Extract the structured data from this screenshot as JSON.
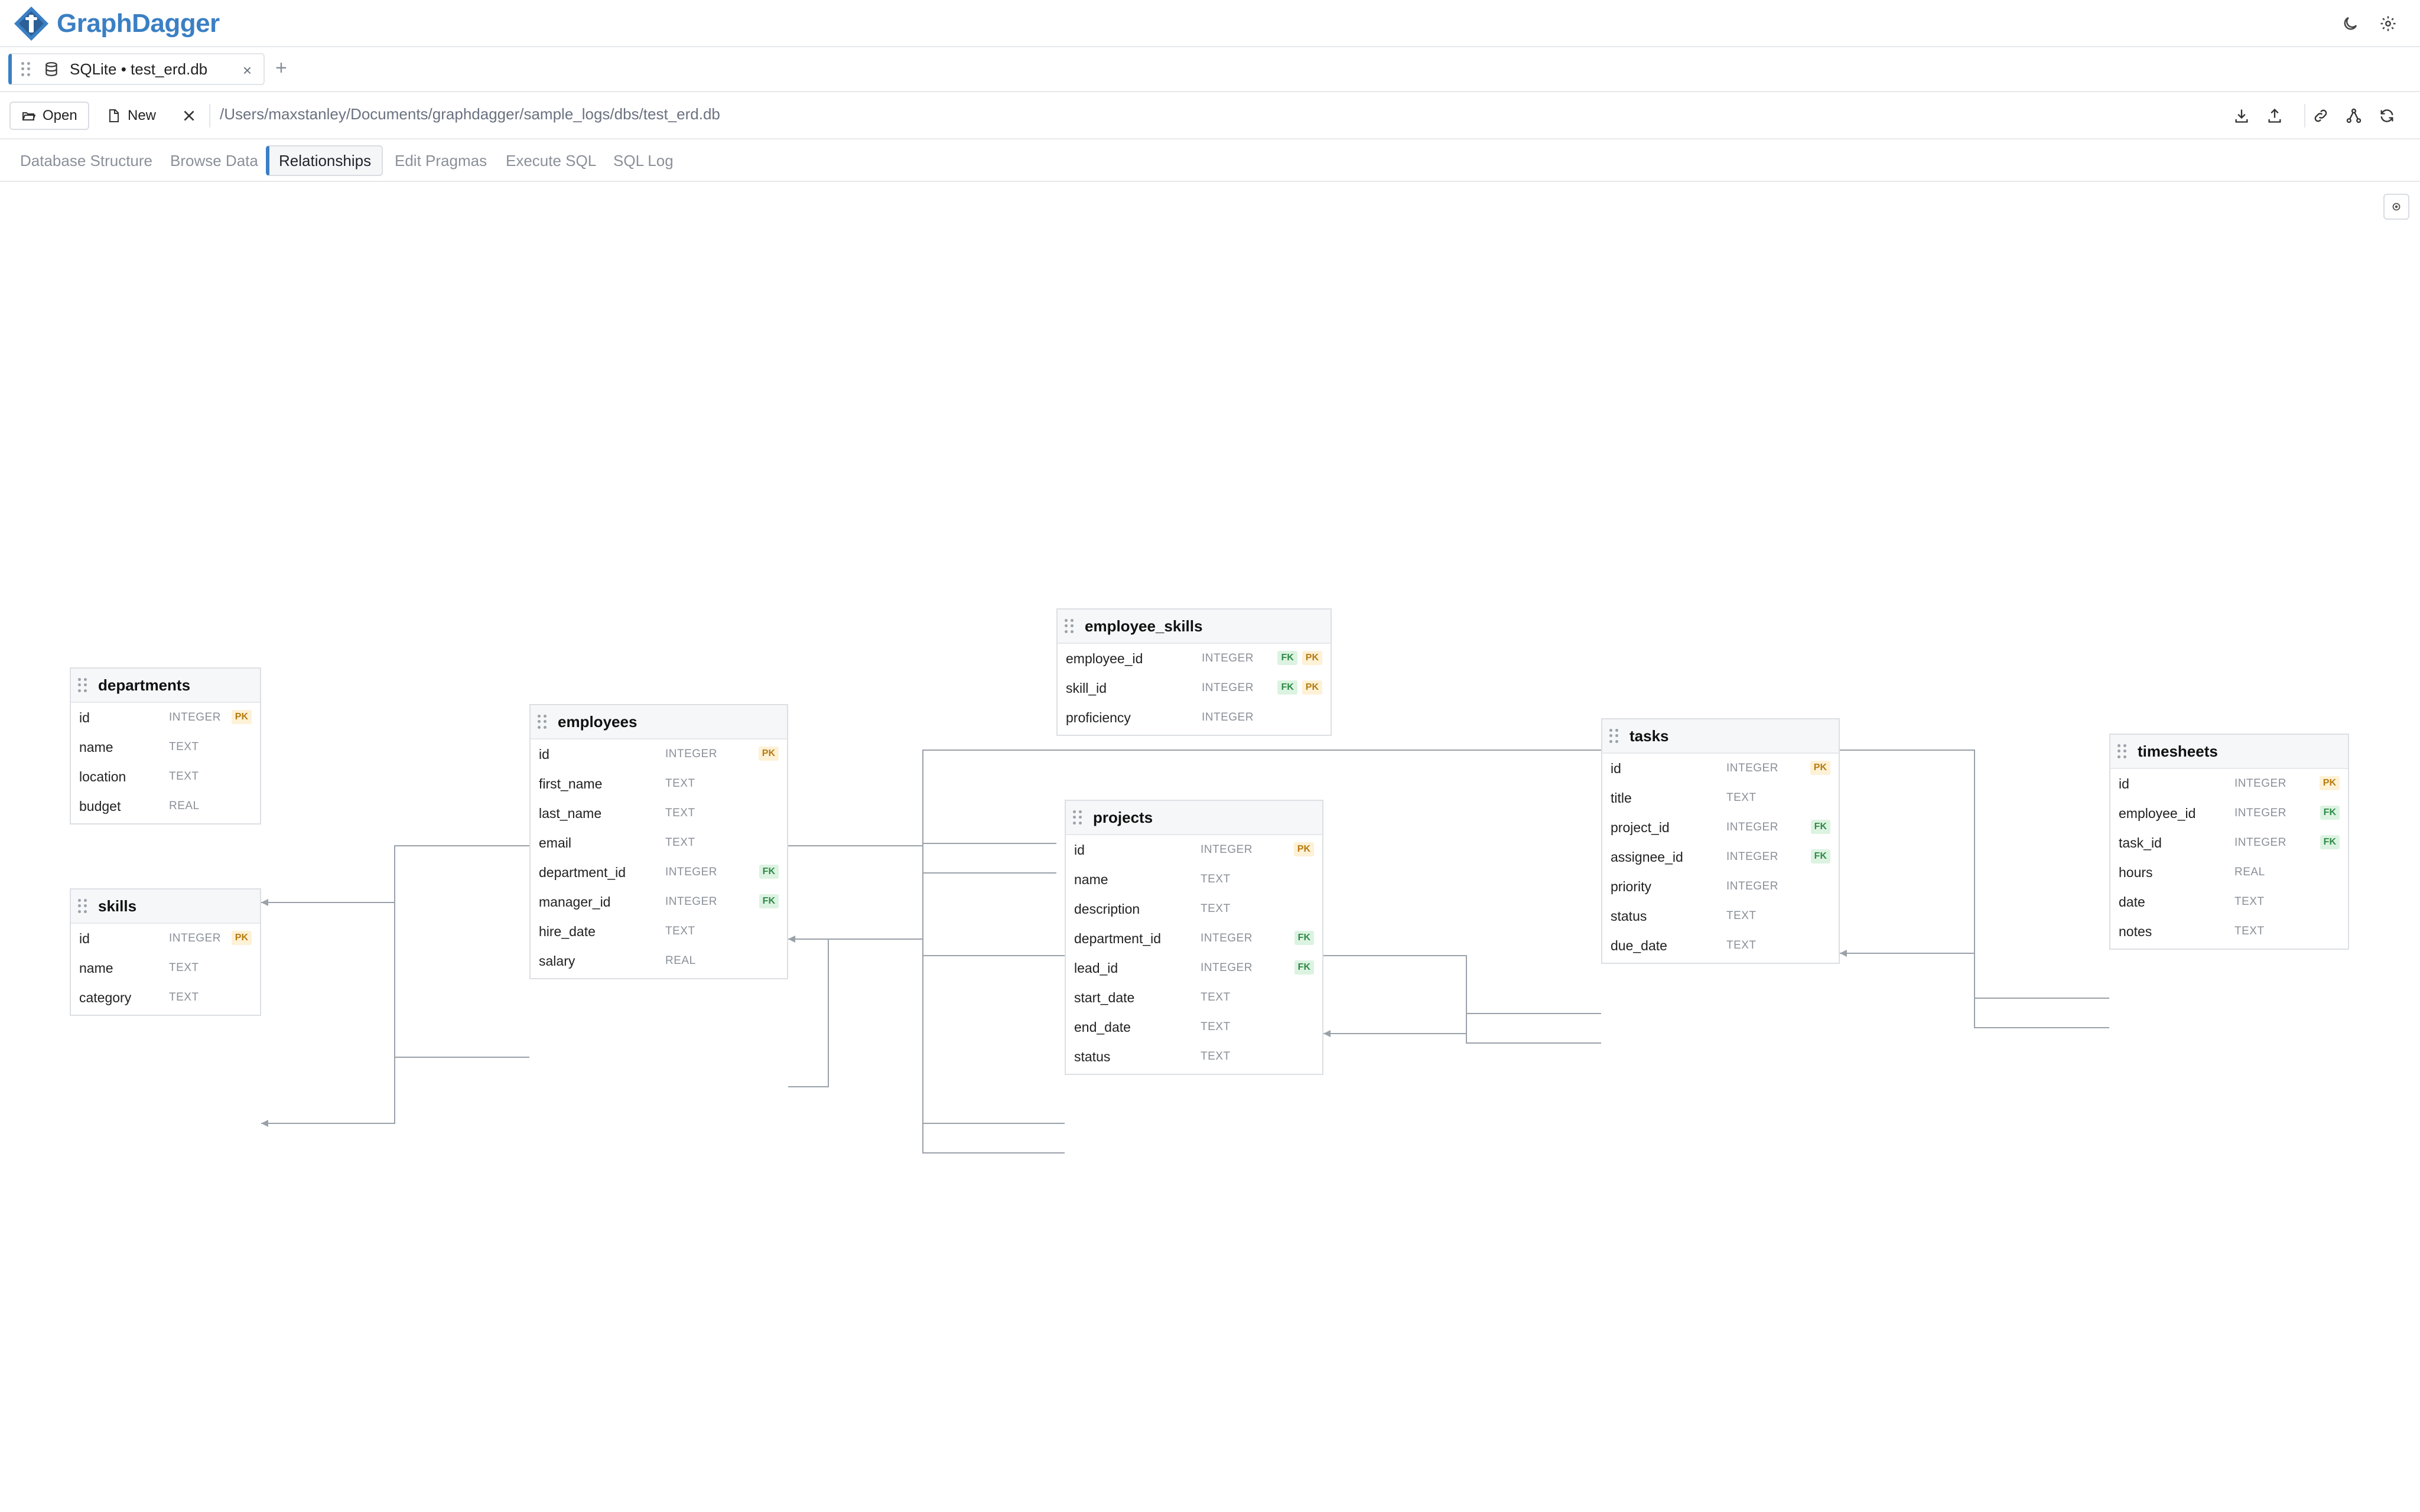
{
  "app": {
    "name": "GraphDagger"
  },
  "db_tab": {
    "label": "SQLite • test_erd.db",
    "close": "×",
    "add": "+"
  },
  "toolbar": {
    "open_label": "Open",
    "new_label": "New",
    "db_path": "/Users/maxstanley/Documents/graphdagger/sample_logs/dbs/test_erd.db"
  },
  "nav_tabs": [
    {
      "label": "Database Structure"
    },
    {
      "label": "Browse Data"
    },
    {
      "label": "Relationships",
      "active": true
    },
    {
      "label": "Edit Pragmas"
    },
    {
      "label": "Execute SQL"
    },
    {
      "label": "SQL Log"
    }
  ],
  "colors": {
    "accent": "#3b7fc4",
    "pk_badge": "#b77b10",
    "fk_badge": "#2f8a47",
    "edge": "#9aa1a9"
  },
  "tables": [
    {
      "name": "departments",
      "columns": [
        {
          "name": "id",
          "type": "INTEGER",
          "badges": [
            "PK"
          ]
        },
        {
          "name": "name",
          "type": "TEXT",
          "badges": []
        },
        {
          "name": "location",
          "type": "TEXT",
          "badges": []
        },
        {
          "name": "budget",
          "type": "REAL",
          "badges": []
        }
      ]
    },
    {
      "name": "skills",
      "columns": [
        {
          "name": "id",
          "type": "INTEGER",
          "badges": [
            "PK"
          ]
        },
        {
          "name": "name",
          "type": "TEXT",
          "badges": []
        },
        {
          "name": "category",
          "type": "TEXT",
          "badges": []
        }
      ]
    },
    {
      "name": "employees",
      "columns": [
        {
          "name": "id",
          "type": "INTEGER",
          "badges": [
            "PK"
          ]
        },
        {
          "name": "first_name",
          "type": "TEXT",
          "badges": []
        },
        {
          "name": "last_name",
          "type": "TEXT",
          "badges": []
        },
        {
          "name": "email",
          "type": "TEXT",
          "badges": []
        },
        {
          "name": "department_id",
          "type": "INTEGER",
          "badges": [
            "FK"
          ]
        },
        {
          "name": "manager_id",
          "type": "INTEGER",
          "badges": [
            "FK"
          ]
        },
        {
          "name": "hire_date",
          "type": "TEXT",
          "badges": []
        },
        {
          "name": "salary",
          "type": "REAL",
          "badges": []
        }
      ]
    },
    {
      "name": "employee_skills",
      "columns": [
        {
          "name": "employee_id",
          "type": "INTEGER",
          "badges": [
            "FK",
            "PK"
          ]
        },
        {
          "name": "skill_id",
          "type": "INTEGER",
          "badges": [
            "FK",
            "PK"
          ]
        },
        {
          "name": "proficiency",
          "type": "INTEGER",
          "badges": []
        }
      ]
    },
    {
      "name": "projects",
      "columns": [
        {
          "name": "id",
          "type": "INTEGER",
          "badges": [
            "PK"
          ]
        },
        {
          "name": "name",
          "type": "TEXT",
          "badges": []
        },
        {
          "name": "description",
          "type": "TEXT",
          "badges": []
        },
        {
          "name": "department_id",
          "type": "INTEGER",
          "badges": [
            "FK"
          ]
        },
        {
          "name": "lead_id",
          "type": "INTEGER",
          "badges": [
            "FK"
          ]
        },
        {
          "name": "start_date",
          "type": "TEXT",
          "badges": []
        },
        {
          "name": "end_date",
          "type": "TEXT",
          "badges": []
        },
        {
          "name": "status",
          "type": "TEXT",
          "badges": []
        }
      ]
    },
    {
      "name": "tasks",
      "columns": [
        {
          "name": "id",
          "type": "INTEGER",
          "badges": [
            "PK"
          ]
        },
        {
          "name": "title",
          "type": "TEXT",
          "badges": []
        },
        {
          "name": "project_id",
          "type": "INTEGER",
          "badges": [
            "FK"
          ]
        },
        {
          "name": "assignee_id",
          "type": "INTEGER",
          "badges": [
            "FK"
          ]
        },
        {
          "name": "priority",
          "type": "INTEGER",
          "badges": []
        },
        {
          "name": "status",
          "type": "TEXT",
          "badges": []
        },
        {
          "name": "due_date",
          "type": "TEXT",
          "badges": []
        }
      ]
    },
    {
      "name": "timesheets",
      "columns": [
        {
          "name": "id",
          "type": "INTEGER",
          "badges": [
            "PK"
          ]
        },
        {
          "name": "employee_id",
          "type": "INTEGER",
          "badges": [
            "FK"
          ]
        },
        {
          "name": "task_id",
          "type": "INTEGER",
          "badges": [
            "FK"
          ]
        },
        {
          "name": "hours",
          "type": "REAL",
          "badges": []
        },
        {
          "name": "date",
          "type": "TEXT",
          "badges": []
        },
        {
          "name": "notes",
          "type": "TEXT",
          "badges": []
        }
      ]
    }
  ],
  "relationships": [
    {
      "from": "employees.department_id",
      "to": "departments.id"
    },
    {
      "from": "employees.manager_id",
      "to": "employees.id"
    },
    {
      "from": "employee_skills.employee_id",
      "to": "employees.id"
    },
    {
      "from": "employee_skills.skill_id",
      "to": "skills.id"
    },
    {
      "from": "projects.department_id",
      "to": "departments.id"
    },
    {
      "from": "projects.lead_id",
      "to": "employees.id"
    },
    {
      "from": "tasks.project_id",
      "to": "projects.id"
    },
    {
      "from": "tasks.assignee_id",
      "to": "employees.id"
    },
    {
      "from": "timesheets.employee_id",
      "to": "employees.id"
    },
    {
      "from": "timesheets.task_id",
      "to": "tasks.id"
    }
  ]
}
